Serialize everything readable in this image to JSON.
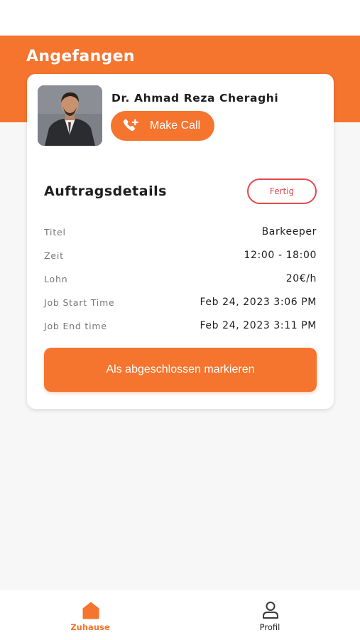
{
  "header": {
    "title": "Angefangen"
  },
  "contact": {
    "name": "Dr. Ahmad Reza Cheraghi",
    "call_label": "Make Call",
    "call_icon": "phone-add-icon",
    "avatar_icon": "person-photo"
  },
  "order": {
    "section_title": "Auftragsdetails",
    "status_label": "Fertig",
    "rows": [
      {
        "label": "Titel",
        "value": "Barkeeper"
      },
      {
        "label": "Zeit",
        "value": "12:00 - 18:00"
      },
      {
        "label": "Lohn",
        "value": "20€/h"
      },
      {
        "label": "Job Start Time",
        "value": "Feb 24, 2023 3:06 PM"
      },
      {
        "label": "Job End time",
        "value": "Feb 24, 2023 3:11 PM"
      }
    ],
    "complete_button": "Als abgeschlossen markieren"
  },
  "tabbar": {
    "items": [
      {
        "label": "Zuhause",
        "icon": "home-icon",
        "active": true
      },
      {
        "label": "Profil",
        "icon": "person-icon",
        "active": false
      }
    ]
  },
  "colors": {
    "accent": "#f5742e",
    "status_red": "#e5484d",
    "background": "#f7f7f7"
  }
}
